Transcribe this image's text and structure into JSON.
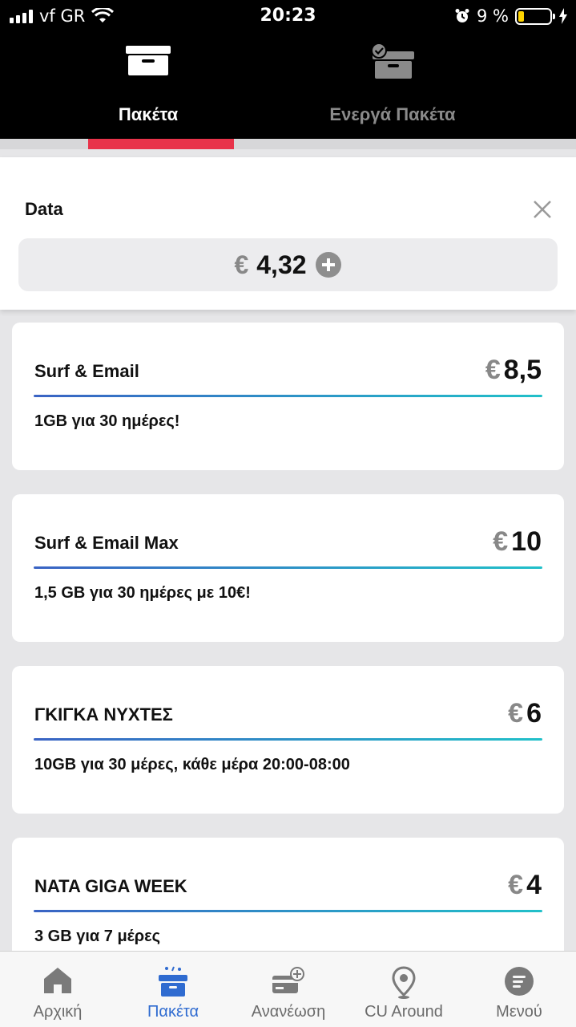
{
  "status_bar": {
    "carrier": "vf GR",
    "time": "20:23",
    "battery_percent": "9 %",
    "battery_level": 0.09
  },
  "tabs": [
    {
      "label": "Πακέτα",
      "icon": "box-icon",
      "active": true
    },
    {
      "label": "Ενεργά Πακέτα",
      "icon": "box-check-icon",
      "active": false
    }
  ],
  "data_panel": {
    "title": "Data",
    "currency": "€",
    "balance": "4,32"
  },
  "packages": [
    {
      "name": "Surf & Email",
      "currency": "€",
      "price": "8,5",
      "description": "1GB για 30 ημέρες!"
    },
    {
      "name": "Surf & Email Max",
      "currency": "€",
      "price": "10",
      "description": "1,5 GB για 30 ημέρες με 10€!"
    },
    {
      "name": "ΓΚΙΓΚΑ ΝΥΧΤΕΣ",
      "currency": "€",
      "price": "6",
      "description": "10GB για 30 μέρες, κάθε μέρα 20:00-08:00"
    },
    {
      "name": "NATA GIGA WEEK",
      "currency": "€",
      "price": "4",
      "description": "3 GB για 7 μέρες"
    }
  ],
  "bottom_nav": [
    {
      "label": "Αρχική",
      "icon": "home-icon",
      "active": false
    },
    {
      "label": "Πακέτα",
      "icon": "box-icon",
      "active": true
    },
    {
      "label": "Ανανέωση",
      "icon": "card-plus-icon",
      "active": false
    },
    {
      "label": "CU Around",
      "icon": "location-pin-icon",
      "active": false
    },
    {
      "label": "Μενού",
      "icon": "menu-icon",
      "active": false
    }
  ],
  "colors": {
    "accent_red": "#e8334a",
    "active_blue": "#2f6bd0",
    "gradient_start": "#3a63c4",
    "gradient_end": "#21c0c9"
  }
}
